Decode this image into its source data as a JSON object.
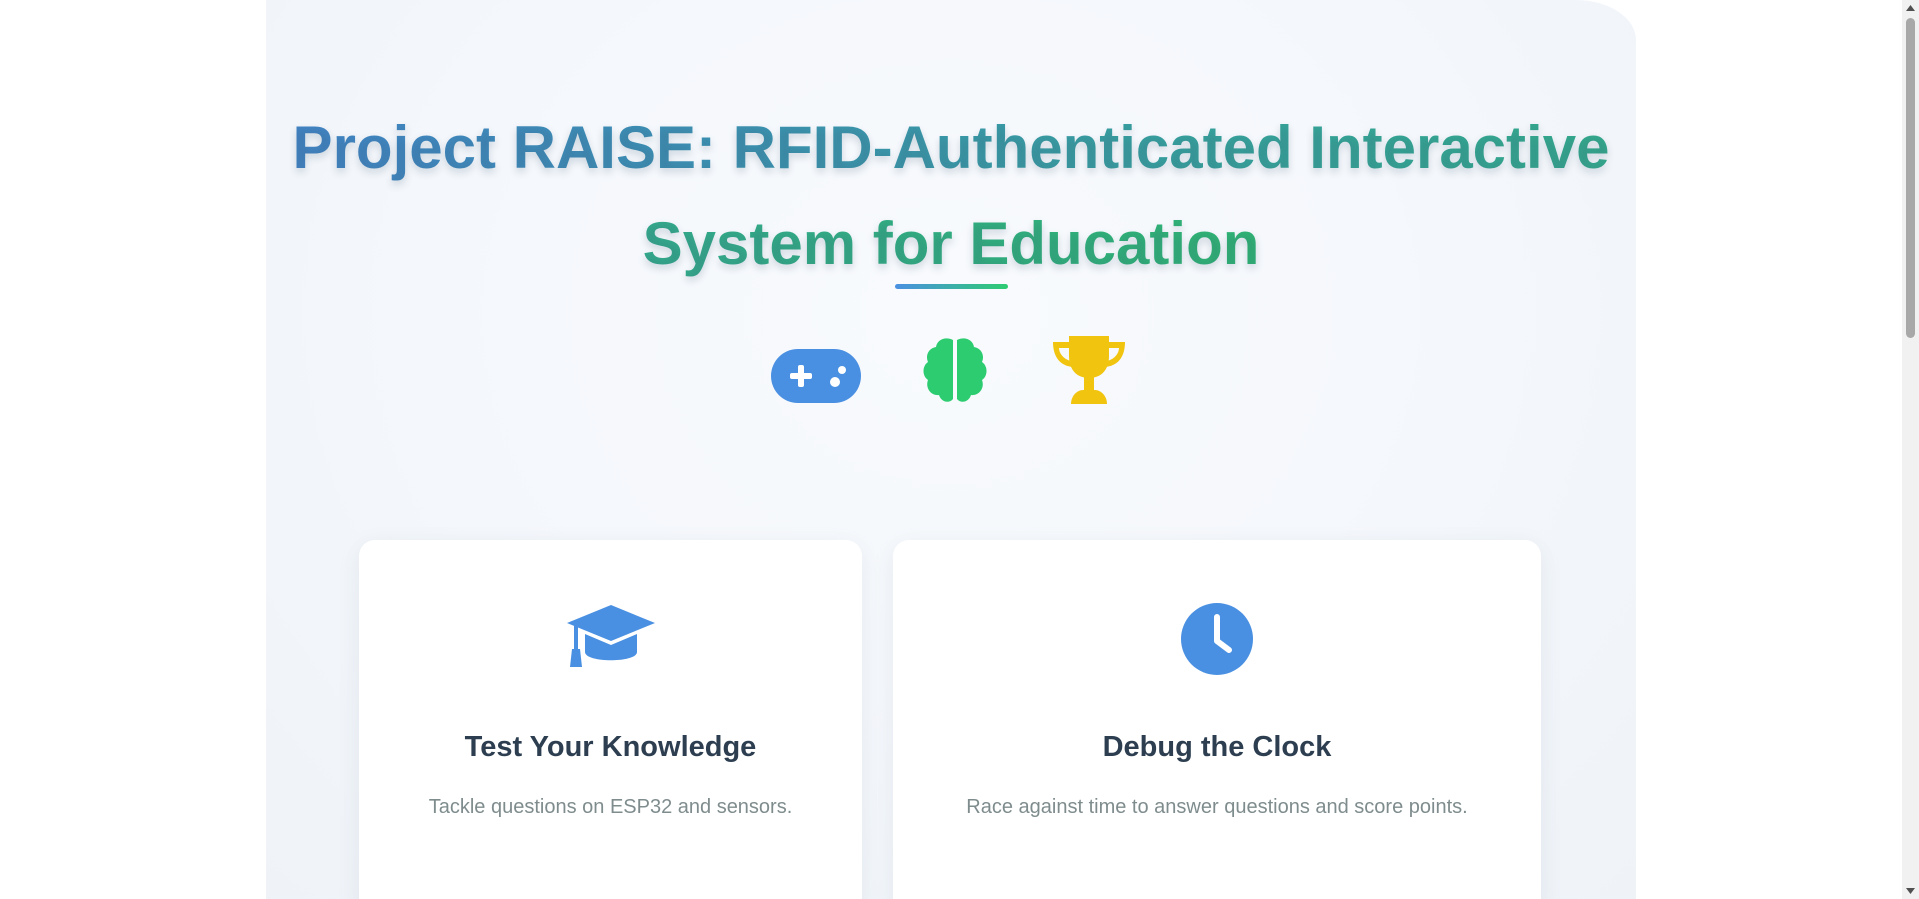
{
  "page": {
    "title": "Project RAISE: RFID-Authenticated Interactive System for Education"
  },
  "hero_icons": [
    "gamepad-icon",
    "brain-icon",
    "trophy-icon"
  ],
  "cards": [
    {
      "icon": "graduation-cap-icon",
      "title": "Test Your Knowledge",
      "description": "Tackle questions on ESP32 and sensors."
    },
    {
      "icon": "clock-icon",
      "title": "Debug the Clock",
      "description": "Race against time to answer questions and score points."
    }
  ],
  "colors": {
    "primary_blue": "#4a90e2",
    "accent_green": "#2ecc71",
    "trophy_gold": "#f1c40f",
    "heading": "#2c3e50",
    "muted_text": "#7f8c8d"
  }
}
